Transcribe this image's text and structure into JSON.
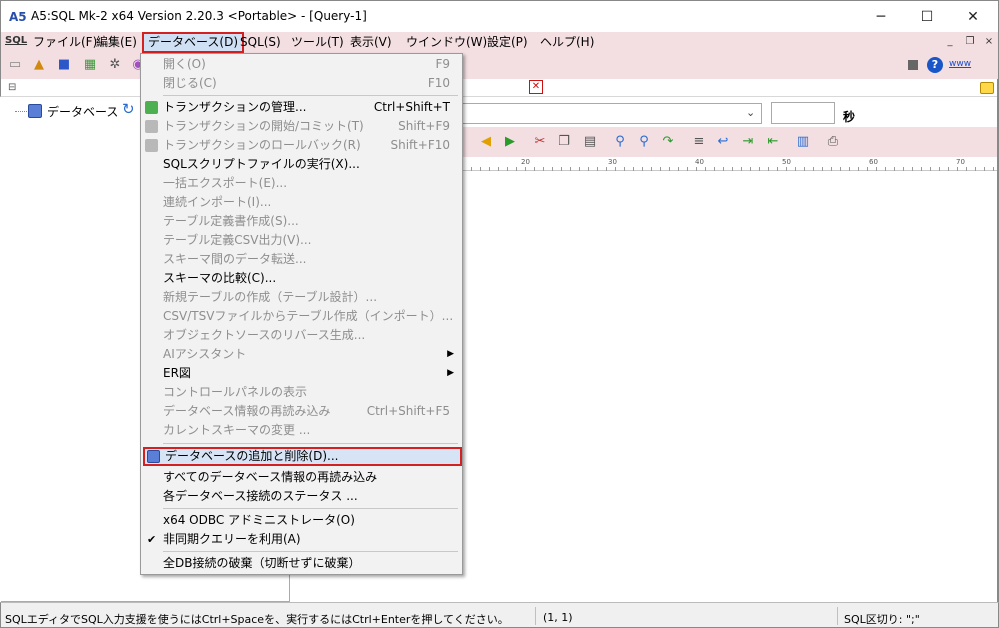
{
  "window": {
    "title": "A5:SQL Mk-2 x64 Version 2.20.3 <Portable> - [Query-1]",
    "icon_text": "A5",
    "minimize": "─",
    "maximize": "☐",
    "close": "✕"
  },
  "menubar": {
    "logo": "SQL",
    "items": [
      {
        "label": "ファイル(F)"
      },
      {
        "label": "編集(E)"
      },
      {
        "label": "データベース(D)"
      },
      {
        "label": "SQL(S)"
      },
      {
        "label": "ツール(T)"
      },
      {
        "label": "表示(V)"
      },
      {
        "label": "ウインドウ(W)"
      },
      {
        "label": "設定(P)"
      },
      {
        "label": "ヘルプ(H)"
      }
    ],
    "mdi_min": "_",
    "mdi_restore": "❐",
    "mdi_close": "×"
  },
  "toolbar": {
    "help": "?",
    "www": "www"
  },
  "tree": {
    "root_label": "データベース"
  },
  "editor": {
    "tab_close": "✕",
    "seconds_label": "秒",
    "ruler_marks": [
      "20",
      "30",
      "40",
      "50",
      "60",
      "70"
    ]
  },
  "db_menu": {
    "items": [
      {
        "label": "開く(O)",
        "shortcut": "F9"
      },
      {
        "label": "閉じる(C)",
        "shortcut": "F10"
      },
      {
        "label": "トランザクションの管理...",
        "shortcut": "Ctrl+Shift+T"
      },
      {
        "label": "トランザクションの開始/コミット(T)",
        "shortcut": "Shift+F9"
      },
      {
        "label": "トランザクションのロールバック(R)",
        "shortcut": "Shift+F10"
      },
      {
        "label": "SQLスクリプトファイルの実行(X)..."
      },
      {
        "label": "一括エクスポート(E)..."
      },
      {
        "label": "連続インポート(I)..."
      },
      {
        "label": "テーブル定義書作成(S)..."
      },
      {
        "label": "テーブル定義CSV出力(V)..."
      },
      {
        "label": "スキーマ間のデータ転送..."
      },
      {
        "label": "スキーマの比較(C)..."
      },
      {
        "label": "新規テーブルの作成（テーブル設計）..."
      },
      {
        "label": "CSV/TSVファイルからテーブル作成（インポート）..."
      },
      {
        "label": "オブジェクトソースのリバース生成..."
      },
      {
        "label": "AIアシスタント",
        "arrow": "▶"
      },
      {
        "label": "ER図",
        "arrow": "▶"
      },
      {
        "label": "コントロールパネルの表示"
      },
      {
        "label": "データベース情報の再読み込み",
        "shortcut": "Ctrl+Shift+F5"
      },
      {
        "label": "カレントスキーマの変更 ..."
      },
      {
        "label": "データベースの追加と削除(D)..."
      },
      {
        "label": "すべてのデータベース情報の再読み込み"
      },
      {
        "label": "各データベース接続のステータス ..."
      },
      {
        "label": "x64 ODBC アドミニストレータ(O)"
      },
      {
        "label": "非同期クエリーを利用(A)",
        "check": "✔"
      },
      {
        "label": "全DB接続の破棄（切断せずに破棄）"
      }
    ]
  },
  "status": {
    "hint": "SQLエディタでSQL入力支援を使うにはCtrl+Spaceを、実行するにはCtrl+Enterを押してください。",
    "position": "(1, 1)",
    "delimiter": "SQL区切り: \";\""
  }
}
